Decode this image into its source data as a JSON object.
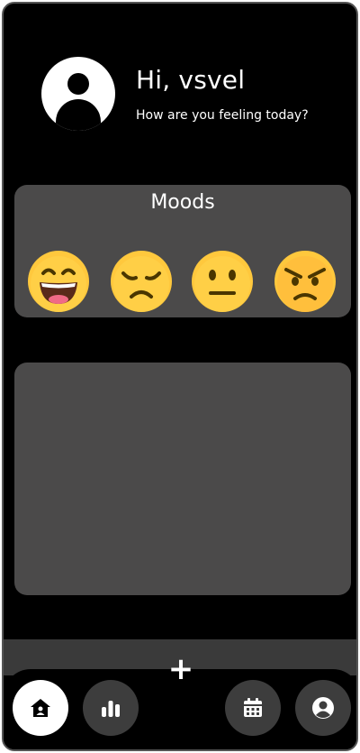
{
  "header": {
    "greeting": "Hi, vsvel",
    "subtitle": "How are you feeling today?",
    "avatar_icon": "user-avatar-icon"
  },
  "moods": {
    "title": "Moods",
    "items": [
      {
        "name": "happy",
        "icon": "grinning-face-icon"
      },
      {
        "name": "sad",
        "icon": "disappointed-face-icon"
      },
      {
        "name": "neutral",
        "icon": "neutral-face-icon"
      },
      {
        "name": "angry",
        "icon": "angry-face-icon"
      }
    ]
  },
  "bottom_nav": {
    "add_label": "+",
    "items": [
      {
        "name": "home",
        "icon": "home-icon",
        "active": true
      },
      {
        "name": "stats",
        "icon": "bar-chart-icon",
        "active": false
      },
      {
        "name": "calendar",
        "icon": "calendar-icon",
        "active": false
      },
      {
        "name": "profile",
        "icon": "profile-icon",
        "active": false
      }
    ]
  },
  "colors": {
    "background": "#000000",
    "card": "#4b4a4a",
    "nav_button": "#3d3d3d",
    "emoji_yellow": "#ffc83d",
    "text": "#ffffff"
  }
}
